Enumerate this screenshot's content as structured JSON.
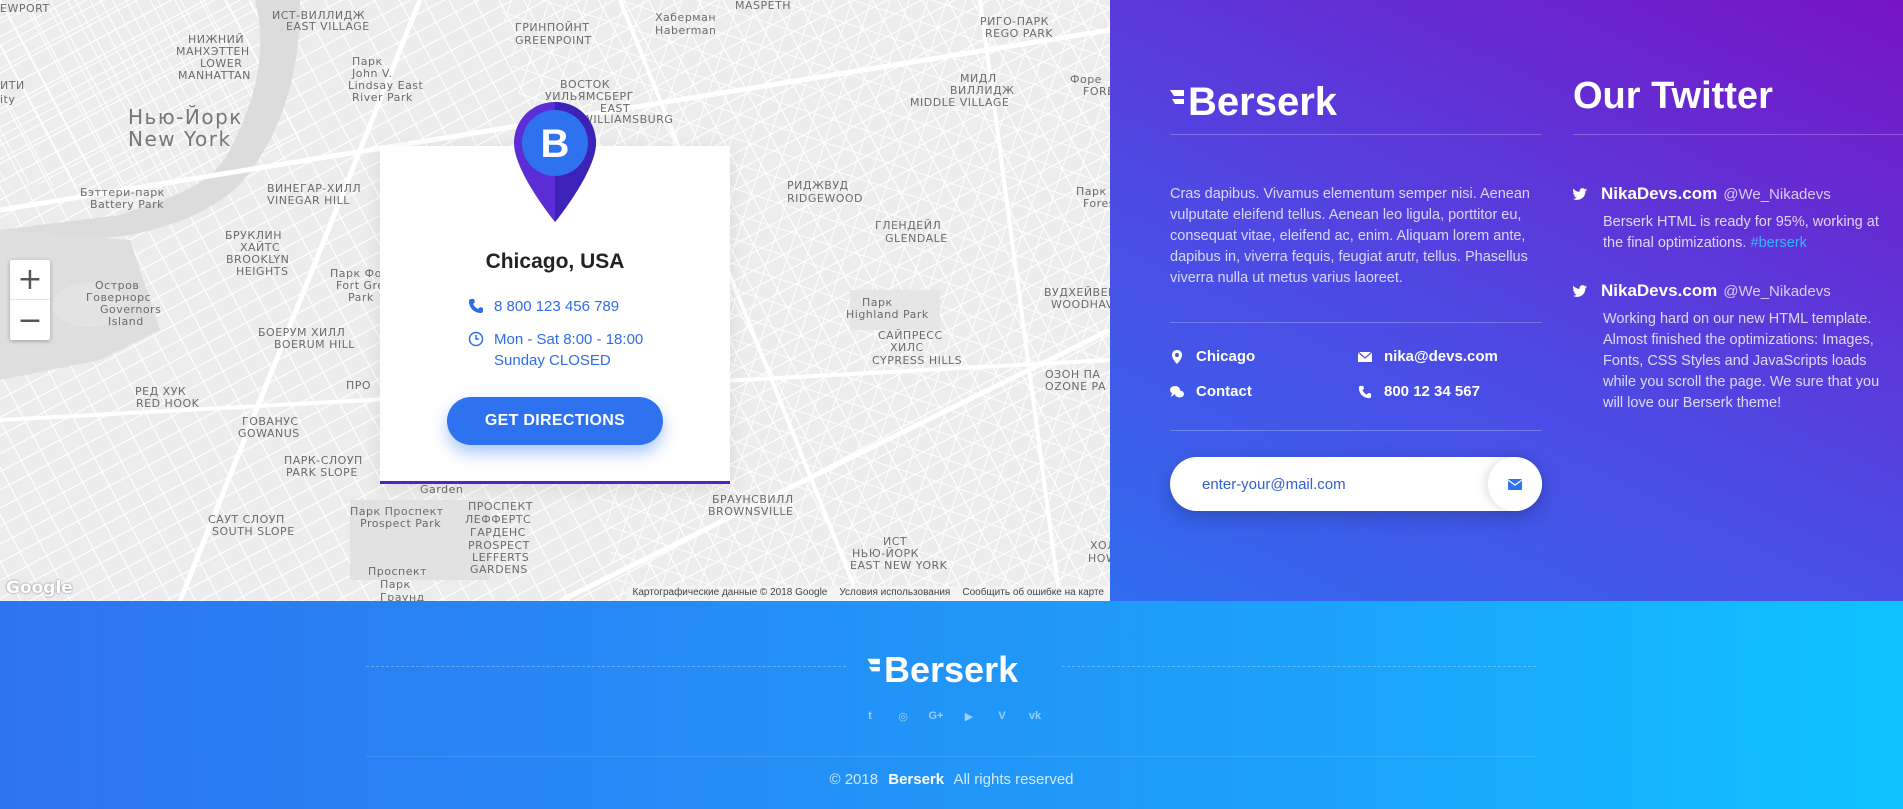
{
  "map": {
    "labels": [
      {
        "t": "EWPORT",
        "big": false
      },
      {
        "t": "ИСТ-ВИЛЛИДЖ",
        "big": false
      },
      {
        "t": "EAST VILLAGE",
        "big": false
      },
      {
        "t": "ГРИНПОЙНТ",
        "big": false
      },
      {
        "t": "GREENPOINT",
        "big": false
      },
      {
        "t": "Хаберман",
        "big": false
      },
      {
        "t": "Haberman",
        "big": false
      },
      {
        "t": "MASPETH",
        "big": false
      },
      {
        "t": "РИГО-ПАРК",
        "big": false
      },
      {
        "t": "REGO PARK",
        "big": false
      },
      {
        "t": "НИЖНИЙ",
        "big": false
      },
      {
        "t": "МАНХЭТТЕН",
        "big": false
      },
      {
        "t": "LOWER",
        "big": false
      },
      {
        "t": "MANHATTAN",
        "big": false
      },
      {
        "t": "Нью-Йорк",
        "big": true
      },
      {
        "t": "New York",
        "big": true
      },
      {
        "t": "ВОСТОК",
        "big": false
      },
      {
        "t": "УИЛЬЯМСБЕРГ",
        "big": false
      },
      {
        "t": "EAST",
        "big": false
      },
      {
        "t": "WILLIAMSBURG",
        "big": false
      },
      {
        "t": "МИДЛ",
        "big": false
      },
      {
        "t": "ВИЛЛИДЖ",
        "big": false
      },
      {
        "t": "MIDDLE VILLAGE",
        "big": false
      },
      {
        "t": "Бэттери-парк",
        "big": false
      },
      {
        "t": "Battery Park",
        "big": false
      },
      {
        "t": "ВИНЕГАР-ХИЛЛ",
        "big": false
      },
      {
        "t": "VINEGAR HILL",
        "big": false
      },
      {
        "t": "РИДЖВУД",
        "big": false
      },
      {
        "t": "RIDGEWOOD",
        "big": false
      },
      {
        "t": "ГЛЕНДЕЙЛ",
        "big": false
      },
      {
        "t": "GLENDALE",
        "big": false
      },
      {
        "t": "БРУКЛИН",
        "big": false
      },
      {
        "t": "ХАЙТС",
        "big": false
      },
      {
        "t": "BROOKLYN",
        "big": false
      },
      {
        "t": "HEIGHTS",
        "big": false
      },
      {
        "t": "Остров",
        "big": false
      },
      {
        "t": "Говернорс",
        "big": false
      },
      {
        "t": "Governors",
        "big": false
      },
      {
        "t": "Island",
        "big": false
      },
      {
        "t": "ВУДХЕЙВЕН",
        "big": false
      },
      {
        "t": "WOODHAVEN",
        "big": false
      },
      {
        "t": "Парк",
        "big": false
      },
      {
        "t": "Highland Park",
        "big": false
      },
      {
        "t": "БОЕРУМ ХИЛЛ",
        "big": false
      },
      {
        "t": "BOERUM HILL",
        "big": false
      },
      {
        "t": "САЙПРЕСС",
        "big": false
      },
      {
        "t": "ХИЛС",
        "big": false
      },
      {
        "t": "CYPRESS HILLS",
        "big": false
      },
      {
        "t": "ОЗОН ПА",
        "big": false
      },
      {
        "t": "OZONE PA",
        "big": false
      },
      {
        "t": "РЕД ХУК",
        "big": false
      },
      {
        "t": "RED HOOK",
        "big": false
      },
      {
        "t": "ГОВАНУС",
        "big": false
      },
      {
        "t": "GOWANUS",
        "big": false
      },
      {
        "t": "ПАРК-СЛОУП",
        "big": false
      },
      {
        "t": "PARK SLOPE",
        "big": false
      },
      {
        "t": "БРАУНСВИЛЛ",
        "big": false
      },
      {
        "t": "BROWNSVILLE",
        "big": false
      },
      {
        "t": "ПРОСПЕКТ",
        "big": false
      },
      {
        "t": "ЛЕФФЕРТС",
        "big": false
      },
      {
        "t": "ГАРДЕНС",
        "big": false
      },
      {
        "t": "PROSPECT",
        "big": false
      },
      {
        "t": "LEFFERTS",
        "big": false
      },
      {
        "t": "GARDENS",
        "big": false
      },
      {
        "t": "САУТ СЛОУП",
        "big": false
      },
      {
        "t": "SOUTH SLOPE",
        "big": false
      },
      {
        "t": "Парк Проспект",
        "big": false
      },
      {
        "t": "Prospect Park",
        "big": false
      },
      {
        "t": "ИСТ",
        "big": false
      },
      {
        "t": "НЬЮ-ЙОРК",
        "big": false
      },
      {
        "t": "EAST NEW YORK",
        "big": false
      },
      {
        "t": "Проспект",
        "big": false
      },
      {
        "t": "Парк",
        "big": false
      },
      {
        "t": "Граунд",
        "big": false
      },
      {
        "t": "Фоpe",
        "big": false
      },
      {
        "t": "FORE",
        "big": false
      },
      {
        "t": "Парк",
        "big": false
      },
      {
        "t": "Fores",
        "big": false
      },
      {
        "t": "ХОЛ",
        "big": false
      },
      {
        "t": "HOW",
        "big": false
      },
      {
        "t": "Парк",
        "big": false
      },
      {
        "t": "John V.",
        "big": false
      },
      {
        "t": "Lindsay East",
        "big": false
      },
      {
        "t": "River Park",
        "big": false
      },
      {
        "t": "Парк Фор",
        "big": false
      },
      {
        "t": "Fort Gree",
        "big": false
      },
      {
        "t": "Park",
        "big": false
      },
      {
        "t": "ИТИ",
        "big": false
      },
      {
        "t": "ity",
        "big": false
      },
      {
        "t": "ПРО",
        "big": false
      },
      {
        "t": "Garden",
        "big": false
      }
    ],
    "zoom_in": "+",
    "zoom_out": "−",
    "google": "Google",
    "footer_links": [
      "Картографические данные © 2018 Google",
      "Условия использования",
      "Сообщить об ошибке на карте"
    ]
  },
  "card": {
    "city": "Chicago, USA",
    "phone": "8 800 123 456 789",
    "hours_1": "Mon - Sat 8:00 - 18:00",
    "hours_2": "Sunday CLOSED",
    "button": "GET DIRECTIONS",
    "pin_letter": "B"
  },
  "panel": {
    "brand": "Berserk",
    "description": "Cras dapibus. Vivamus elementum semper nisi. Aenean vulputate eleifend tellus. Aenean leo ligula, porttitor eu, consequat vitae, eleifend ac, enim. Aliquam lorem ante, dapibus in, viverra fequis, feugiat arutr, tellus. Phasellus viverra nulla ut metus varius laoreet.",
    "contacts": {
      "city": "Chicago",
      "email": "nika@devs.com",
      "contact": "Contact",
      "phone": "800 12 34 567"
    },
    "subscribe_placeholder": "enter-your@mail.com"
  },
  "twitter": {
    "title": "Our Twitter",
    "tweets": [
      {
        "name": "NikaDevs.com",
        "handle": "@We_Nikadevs",
        "text": "Berserk HTML is ready for 95%, working at the final optimizations.",
        "tag": "#berserk"
      },
      {
        "name": "NikaDevs.com",
        "handle": "@We_Nikadevs",
        "text": "Working hard on our new HTML template. Almost finished the optimizations: Images, Fonts, CSS Styles and JavaScripts loads while you scroll the page.  We sure that you will love our Berserk theme!",
        "tag": ""
      }
    ]
  },
  "footer": {
    "brand": "Berserk",
    "socials": [
      "twitter-icon",
      "instagram-icon",
      "google-plus-icon",
      "youtube-icon",
      "vimeo-icon",
      "vk-icon"
    ],
    "social_glyphs": [
      "t",
      "◎",
      "G+",
      "▶",
      "V",
      "vk"
    ],
    "copyright_year": "© 2018",
    "copyright_brand": "Berserk",
    "copyright_rest": "All rights reserved"
  },
  "colors": {
    "accent": "#2e72f0",
    "purple": "#7714c4",
    "footer_cyan": "#0fc3ff"
  }
}
